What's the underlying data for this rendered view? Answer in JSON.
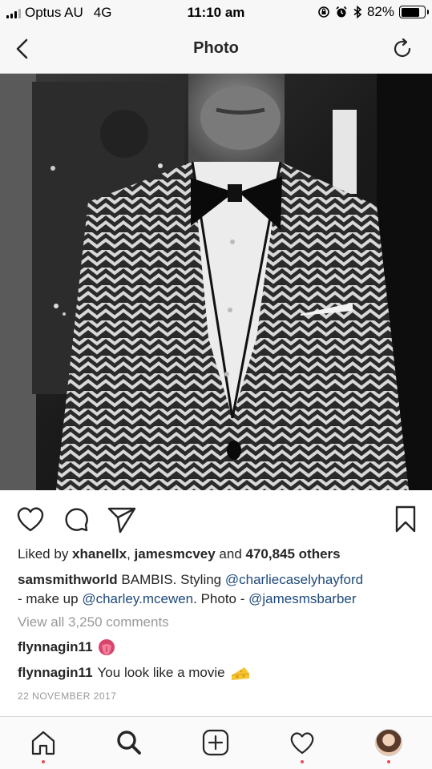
{
  "status_bar": {
    "carrier": "Optus AU",
    "network": "4G",
    "time": "11:10 am",
    "battery_percent": "82%",
    "battery_level": 0.82
  },
  "nav": {
    "title": "Photo"
  },
  "post": {
    "liked_by_prefix": "Liked by ",
    "liker_1": "xhanellx",
    "liker_sep": ", ",
    "liker_2": "jamesmcvey",
    "and_text": " and ",
    "others_count": "470,845 others",
    "author": "samsmithworld",
    "caption_text": " BAMBIS. Styling ",
    "mention_1": "@charliecaselyhayford",
    "caption_mid": " - make up ",
    "mention_2": "@charley.mcewen",
    "caption_mid2": ". Photo - ",
    "mention_3": "@jamesmsbarber",
    "view_all_comments": "View all 3,250 comments",
    "comments": [
      {
        "user": "flynnagin11",
        "text": "",
        "emoji": "tongue-emoji"
      },
      {
        "user": "flynnagin11",
        "text": "You look like a movie",
        "emoji": "cheese-emoji"
      }
    ],
    "date": "22 NOVEMBER 2017"
  },
  "icons": {
    "back": "chevron-left-icon",
    "refresh": "refresh-icon",
    "like": "heart-icon",
    "comment": "comment-icon",
    "share": "send-icon",
    "save": "bookmark-icon",
    "home": "home-icon",
    "search": "search-icon",
    "add": "add-post-icon",
    "activity": "heart-icon",
    "profile": "avatar"
  },
  "colors": {
    "link": "#1f4a7a",
    "notification_dot": "#ed4956"
  }
}
